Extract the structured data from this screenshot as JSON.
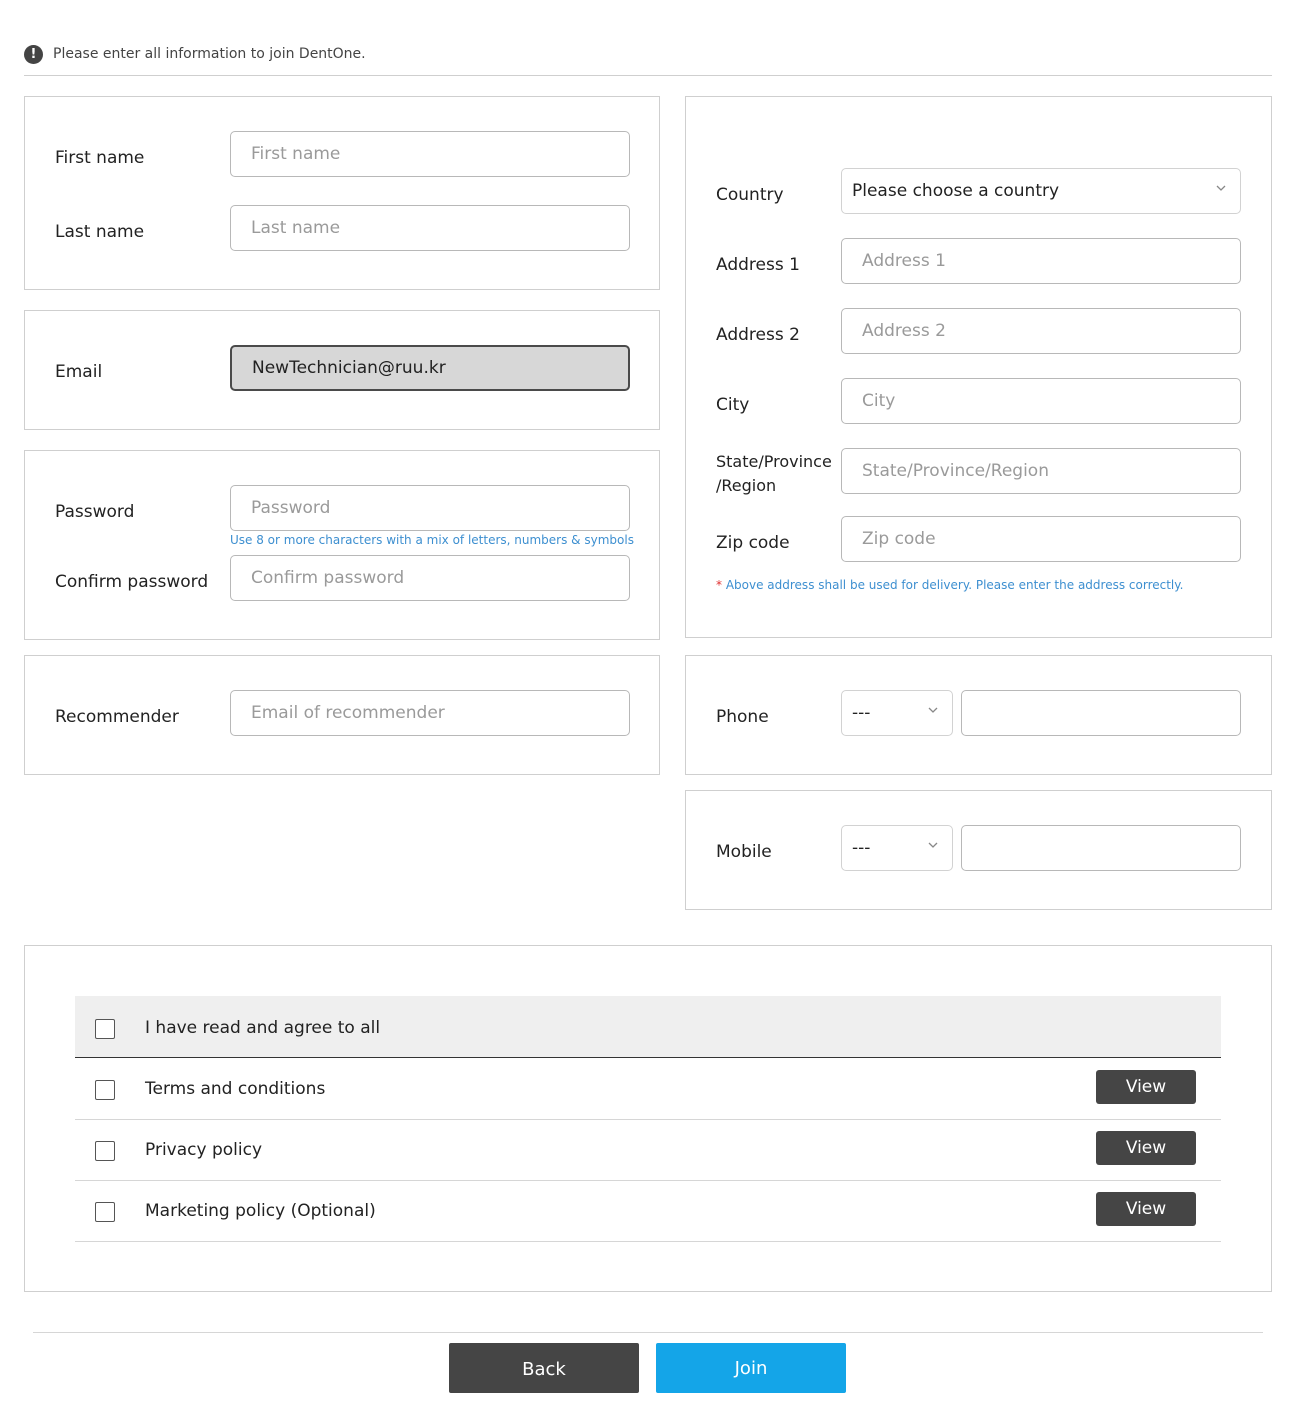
{
  "notice": {
    "icon": "exclamation-circle-icon",
    "text": "Please enter all information to join DentOne."
  },
  "name_section": {
    "first_name_label": "First name",
    "first_name_placeholder": "First name",
    "last_name_label": "Last name",
    "last_name_placeholder": "Last name"
  },
  "email_section": {
    "label": "Email",
    "value": "NewTechnician@ruu.kr"
  },
  "password_section": {
    "password_label": "Password",
    "password_placeholder": "Password",
    "password_hint": "Use 8 or more characters with a mix of letters, numbers & symbols",
    "confirm_label": "Confirm password",
    "confirm_placeholder": "Confirm password"
  },
  "recommender_section": {
    "label": "Recommender",
    "placeholder": "Email of recommender"
  },
  "address_section": {
    "country_label": "Country",
    "country_selected": "Please choose a country",
    "address1_label": "Address 1",
    "address1_placeholder": "Address 1",
    "address2_label": "Address 2",
    "address2_placeholder": "Address 2",
    "city_label": "City",
    "city_placeholder": "City",
    "state_label_line1": "State/Province",
    "state_label_line2": "/Region",
    "state_placeholder": "State/Province/Region",
    "zip_label": "Zip code",
    "zip_placeholder": "Zip code",
    "note_star": "*",
    "note": "Above address shall be used for delivery. Please enter the address correctly."
  },
  "phone_section": {
    "label": "Phone",
    "code_selected": "---",
    "number_value": ""
  },
  "mobile_section": {
    "label": "Mobile",
    "code_selected": "---",
    "number_value": ""
  },
  "agreements": {
    "agree_all_label": "I have read and agree to all",
    "items": [
      {
        "label": "Terms and conditions",
        "button": "View",
        "checked": false
      },
      {
        "label": "Privacy policy",
        "button": "View",
        "checked": false
      },
      {
        "label": "Marketing policy (Optional)",
        "button": "View",
        "checked": false
      }
    ]
  },
  "footer": {
    "back_label": "Back",
    "join_label": "Join"
  },
  "colors": {
    "join_button": "#14a5e8",
    "dark_button": "#454545",
    "hint_text": "#3d8fd0",
    "required_star": "#e03030"
  }
}
